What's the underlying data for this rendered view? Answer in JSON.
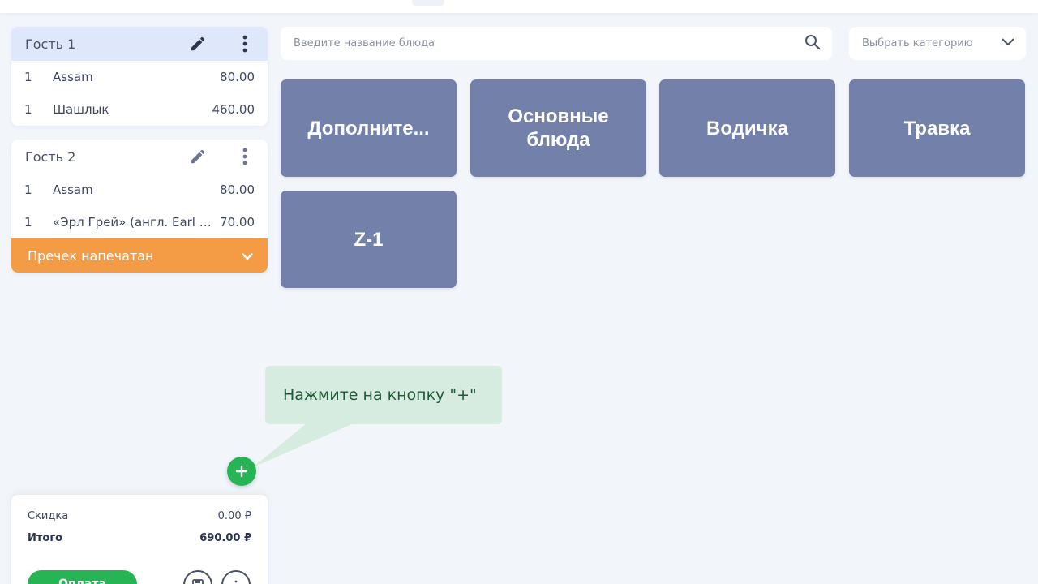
{
  "guests": [
    {
      "title": "Гость 1",
      "items": [
        {
          "qty": "1",
          "name": "Assam",
          "price": "80.00"
        },
        {
          "qty": "1",
          "name": "Шашлык",
          "price": "460.00"
        }
      ]
    },
    {
      "title": "Гость 2",
      "items": [
        {
          "qty": "1",
          "name": "Assam",
          "price": "80.00"
        },
        {
          "qty": "1",
          "name": "«Эрл Грей» (англ. Earl Grey)",
          "price": "70.00"
        }
      ],
      "precheck_label": "Пречек напечатан"
    }
  ],
  "search": {
    "placeholder": "Введите название блюда"
  },
  "category": {
    "label": "Выбрать категорию"
  },
  "tiles": [
    {
      "label": "Дополните..."
    },
    {
      "label": "Основные блюда"
    },
    {
      "label": "Водичка"
    },
    {
      "label": "Травка"
    },
    {
      "label": "Z-1"
    }
  ],
  "tooltip": {
    "text": "Нажмите на кнопку \"+\""
  },
  "totals": {
    "discount_label": "Скидка",
    "discount_value": "0.00 ₽",
    "total_label": "Итого",
    "total_value": "690.00 ₽",
    "pay_label": "Оплата"
  },
  "colors": {
    "accent_blue": "#dfe8fa",
    "tile": "#7381aa",
    "precheck": "#f49c45",
    "green": "#27b455"
  },
  "icons": [
    "pencil-icon",
    "more-vertical-icon",
    "search-icon",
    "chevron-down-icon",
    "plus-icon",
    "save-icon",
    "info-icon"
  ]
}
